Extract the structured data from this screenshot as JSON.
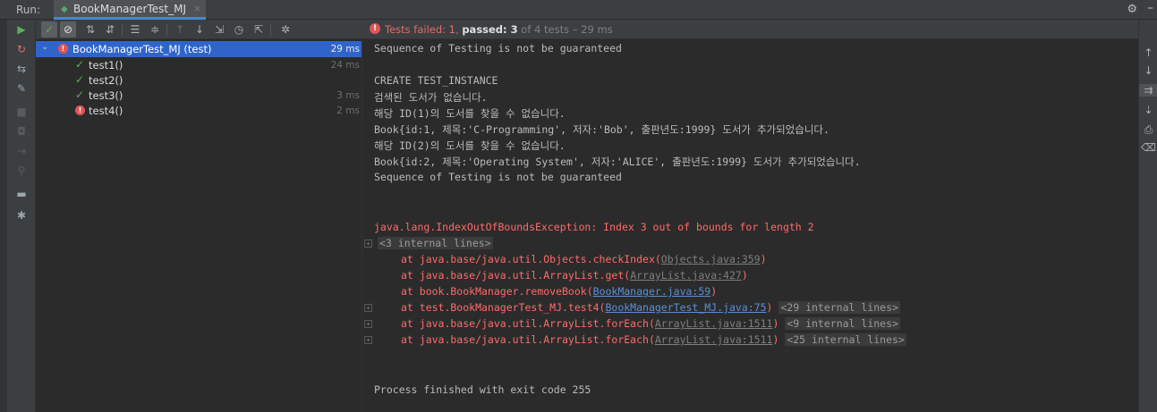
{
  "run_label": "Run:",
  "tab": {
    "title": "BookManagerTest_MJ",
    "close": "×",
    "icon": "test-config-icon"
  },
  "top_icons": {
    "gear": "⚙",
    "minimize": "–"
  },
  "status": {
    "failed": "Tests failed: 1",
    "sep": ", ",
    "passed": "passed: 3",
    "rest": " of 4 tests – 29 ms"
  },
  "tree": {
    "root": {
      "label": "BookManagerTest_MJ (test)",
      "time": "29 ms",
      "status": "failed"
    },
    "items": [
      {
        "label": "test1()",
        "time": "24 ms",
        "status": "passed"
      },
      {
        "label": "test2()",
        "time": "",
        "status": "passed"
      },
      {
        "label": "test3()",
        "time": "3 ms",
        "status": "passed"
      },
      {
        "label": "test4()",
        "time": "2 ms",
        "status": "failed"
      }
    ]
  },
  "console": {
    "l1": "Sequence of Testing is not be guaranteed",
    "l2": "CREATE TEST_INSTANCE",
    "l3": "검색된 도서가 없습니다.",
    "l4": "해당 ID(1)의 도서를 찾을 수 없습니다.",
    "l5": "Book{id:1, 제목:'C-Programming', 저자:'Bob', 출판년도:1999} 도서가 추가되었습니다.",
    "l6": "해당 ID(2)의 도서를 찾을 수 없습니다.",
    "l7": "Book{id:2, 제목:'Operating System', 저자:'ALICE', 출판년도:1999} 도서가 추가되었습니다.",
    "l8": "Sequence of Testing is not be guaranteed",
    "exception": "java.lang.IndexOutOfBoundsException: Index 3 out of bounds for length 2",
    "internal1": "<3 internal lines>",
    "stack": [
      {
        "prefix": "at java.base/java.util.Objects.checkIndex(",
        "link": "Objects.java:359",
        "suffix": ")",
        "extra": ""
      },
      {
        "prefix": "at java.base/java.util.ArrayList.get(",
        "link": "ArrayList.java:427",
        "suffix": ")",
        "extra": ""
      },
      {
        "prefix": "at book.BookManager.removeBook(",
        "link": "BookManager.java:59",
        "suffix": ")",
        "extra": ""
      },
      {
        "prefix": "at test.BookManagerTest_MJ.test4(",
        "link": "BookManagerTest_MJ.java:75",
        "suffix": ")",
        "extra": "<29 internal lines>"
      },
      {
        "prefix": "at java.base/java.util.ArrayList.forEach(",
        "link": "ArrayList.java:1511",
        "suffix": ")",
        "extra": "<9 internal lines>"
      },
      {
        "prefix": "at java.base/java.util.ArrayList.forEach(",
        "link": "ArrayList.java:1511",
        "suffix": ")",
        "extra": "<25 internal lines>"
      }
    ],
    "exit": "Process finished with exit code 255"
  },
  "colors": {
    "accent": "#2f65ca",
    "error": "#ff6b68",
    "pass": "#5fad56",
    "link": "#5a8fd6"
  }
}
